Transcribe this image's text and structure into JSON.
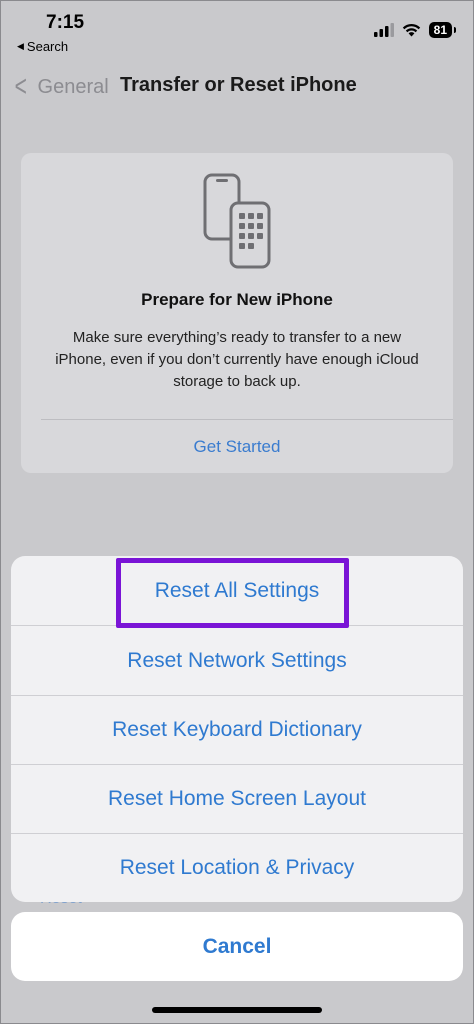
{
  "status_bar": {
    "time": "7:15",
    "back_app": "Search",
    "battery": "81"
  },
  "nav": {
    "back_label": "General",
    "title": "Transfer or Reset iPhone"
  },
  "prepare_card": {
    "icon": "two-phones-icon",
    "title": "Prepare for New iPhone",
    "description": "Make sure everything’s ready to transfer to a new iPhone, even if you don’t currently have enough iCloud storage to back up.",
    "action": "Get Started"
  },
  "behind": {
    "label": "Reset"
  },
  "action_sheet": {
    "items": [
      {
        "label": "Reset All Settings"
      },
      {
        "label": "Reset Network Settings"
      },
      {
        "label": "Reset Keyboard Dictionary"
      },
      {
        "label": "Reset Home Screen Layout"
      },
      {
        "label": "Reset Location & Privacy"
      }
    ],
    "cancel": "Cancel",
    "highlight_color": "#7a14d6",
    "accent_color": "#2f7ad0"
  }
}
